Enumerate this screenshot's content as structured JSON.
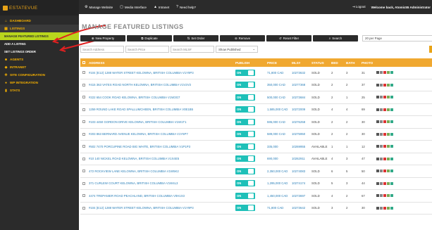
{
  "sidebar": {
    "logo_text": "ESTATEVUE",
    "items": [
      {
        "label": "DASHBOARD",
        "icon": "home-icon"
      },
      {
        "label": "LISTINGS",
        "icon": "building-icon"
      },
      {
        "label": "AGENTS",
        "icon": "users-icon"
      },
      {
        "label": "INTRANET",
        "icon": "tag-icon"
      },
      {
        "label": "SITE CONFIGURATION",
        "icon": "gear-icon"
      },
      {
        "label": "WP INTEGRATION",
        "icon": "wordpress-icon"
      },
      {
        "label": "STATS",
        "icon": "stats-icon"
      }
    ],
    "sub_items": [
      {
        "label": "MANAGE FEATURED LISTINGS"
      },
      {
        "label": "ADD A LISTING"
      },
      {
        "label": "SET LISTINGS ORDER"
      }
    ]
  },
  "topbar": {
    "links": [
      {
        "label": "Manage Website",
        "icon": "gear-icon"
      },
      {
        "label": "Media Interface",
        "icon": "file-icon"
      },
      {
        "label": "Intranet",
        "icon": "lock-icon"
      },
      {
        "label": "Need help?",
        "icon": "question-icon"
      }
    ],
    "logout": "Logout",
    "welcome": "Welcome back, Atomic55 Administrator"
  },
  "page_title": "MANAGE FEATURED LISTINGS",
  "toolbar": {
    "buttons": [
      {
        "label": "New Property",
        "icon": "plus-icon"
      },
      {
        "label": "Duplicate",
        "icon": "duplicate-icon"
      },
      {
        "label": "Set Order",
        "icon": "sort-icon"
      },
      {
        "label": "Remove",
        "icon": "remove-icon"
      },
      {
        "label": "Reset Filter",
        "icon": "reset-icon"
      },
      {
        "label": "Search",
        "icon": "search-icon"
      }
    ],
    "per_page": "20 per Page"
  },
  "filters": {
    "address_placeholder": "Search Address",
    "price_placeholder": "Search Price",
    "mls_placeholder": "Search MLS#",
    "show_select": "Show Published"
  },
  "table": {
    "headers": {
      "address": "ADDRESS",
      "publish": "PUBLISH",
      "price": "PRICE",
      "mls": "MLS#",
      "status": "STATUS",
      "bed": "BED",
      "bath": "BATH",
      "photo": "PHOTO"
    },
    "toggle_label": "ON",
    "rows": [
      {
        "address": "#104 (E12) 1288 WATER STREET KELOWNA, BRITISH COLUMBIA V1Y9P3",
        "price": "71,800 CAD",
        "mls": "10273632",
        "status": "SOLD",
        "bed": "2",
        "bath": "3",
        "photo": "31"
      },
      {
        "address": "#415 363 VATES ROAD NORTH KELOWNA, BRITISH COLUMBIA V1V2V3",
        "price": "350,000 CAD",
        "mls": "10277368",
        "status": "SOLD",
        "bed": "2",
        "bath": "2",
        "photo": "37"
      },
      {
        "address": "#222 654 COOK ROAD KELOWNA, BRITISH COLUMBIA V1W3G7",
        "price": "500,000 CAD",
        "mls": "10273684",
        "status": "SOLD",
        "bed": "2",
        "bath": "1",
        "photo": "25"
      },
      {
        "address": "1259 ROUND LAKE ROAD SPALLUMCHEEN, BRITISH COLUMBIA V0E1B5",
        "price": "1,585,000 CAD",
        "mls": "10272009",
        "status": "SOLD",
        "bed": "4",
        "bath": "4",
        "photo": "69"
      },
      {
        "address": "#103 4450 GORDON DRIVE KELOWNA, BRITISH COLUMBIA V1W1T1",
        "price": "595,000 CAD",
        "mls": "10276258",
        "status": "SOLD",
        "bed": "2",
        "bath": "2",
        "photo": "30"
      },
      {
        "address": "#203 863 BERNARD AVENUE KELOWNA, BRITISH COLUMBIA V1Y6P7",
        "price": "589,000 CAD",
        "mls": "10275950",
        "status": "SOLD",
        "bed": "2",
        "bath": "2",
        "photo": "30"
      },
      {
        "address": "#502 7470 PORCUPINE ROAD BIG WHITE, BRITISH COLUMBIA V1P1P3",
        "price": "335,000",
        "mls": "10269955",
        "status": "AVAILABLE",
        "bed": "1",
        "bath": "1",
        "photo": "12"
      },
      {
        "address": "#10 140 NICKEL ROAD KELOWNA, BRITISH COLUMBIA V1X4E5",
        "price": "690,000",
        "mls": "10262911",
        "status": "AVAILABLE",
        "bed": "4",
        "bath": "3",
        "photo": "47"
      },
      {
        "address": "472 ROCKVIEW LANE KELOWNA, BRITISH COLUMBIA V1W5K2",
        "price": "2,350,000 CAD",
        "mls": "10274083",
        "status": "SOLD",
        "bed": "6",
        "bath": "5",
        "photo": "50"
      },
      {
        "address": "371 CURLEW COURT KELOWNA, BRITISH COLUMBIA V1W4L3",
        "price": "1,295,000 CAD",
        "mls": "10274174",
        "status": "SOLD",
        "bed": "5",
        "bath": "3",
        "photo": "44"
      },
      {
        "address": "4474 TREPANIER ROAD PEACHLAND, BRITISH COLUMBIA V0H1X3",
        "price": "1,450,000 CAD",
        "mls": "10273697",
        "status": "SOLD",
        "bed": "4",
        "bath": "2",
        "photo": "67"
      },
      {
        "address": "#104 (E12) 1288 WATER STREET KELOWNA, BRITISH COLUMBIA V1Y9P3",
        "price": "71,800 CAD",
        "mls": "10273642",
        "status": "SOLD",
        "bed": "3",
        "bath": "2",
        "photo": "30"
      }
    ]
  },
  "colors": {
    "accent": "#f0a830",
    "brand": "#e8a317",
    "toggle": "#1ec0b8",
    "active_sub": "#b9d61d",
    "dark": "#2b2b2b",
    "link": "#2a7fb8"
  }
}
